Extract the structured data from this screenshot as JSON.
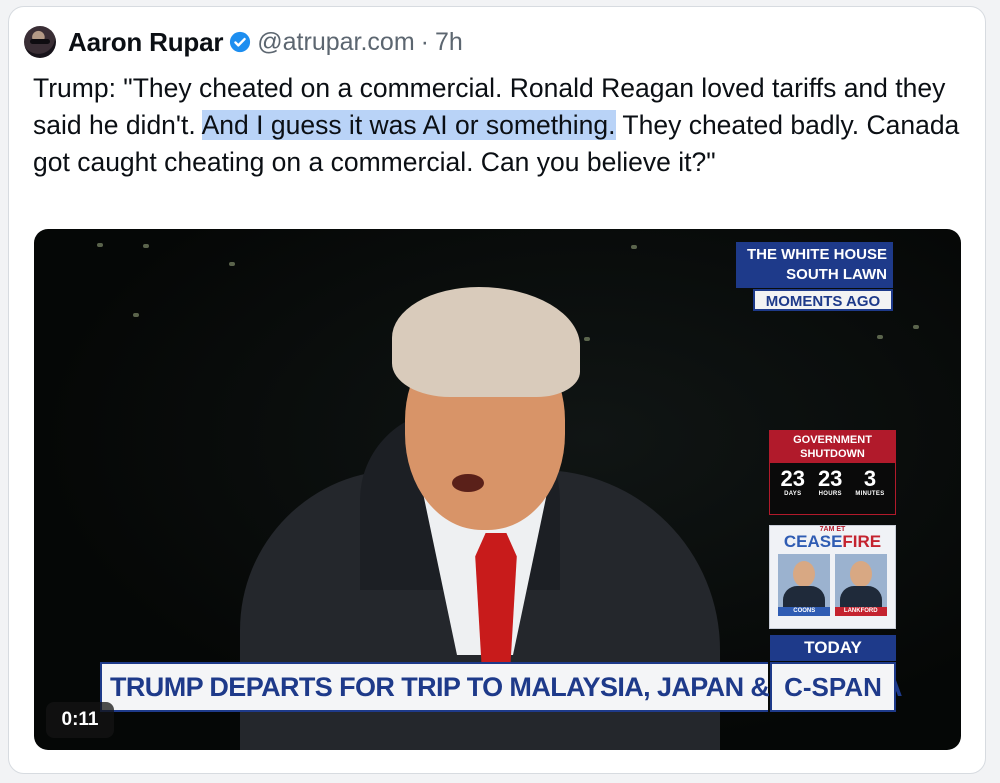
{
  "post": {
    "author_name": "Aaron Rupar",
    "handle": "@atrupar.com",
    "separator": "·",
    "time": "7h",
    "text_before": "Trump: \"They cheated on a commercial. Ronald Reagan loved tariffs and they said he didn't. ",
    "text_highlight": "And I guess it was AI or something.",
    "text_after": " They cheated badly. Canada got caught cheating on a commercial. Can you believe it?\""
  },
  "video": {
    "duration": "0:11",
    "location_line1": "THE WHITE HOUSE",
    "location_line2": "SOUTH LAWN",
    "moments": "MOMENTS AGO",
    "shutdown_title_line1": "GOVERNMENT",
    "shutdown_title_line2": "SHUTDOWN",
    "countdown": [
      {
        "value": "23",
        "label": "DAYS"
      },
      {
        "value": "23",
        "label": "HOURS"
      },
      {
        "value": "3",
        "label": "MINUTES"
      }
    ],
    "ceasefire_time": "7AM ET",
    "ceasefire_a": "CEASE",
    "ceasefire_b": "FIRE",
    "guest1": "COONS",
    "guest2": "LANKFORD",
    "today": "TODAY",
    "headline": "TRUMP DEPARTS FOR TRIP TO MALAYSIA, JAPAN & S. KOREA",
    "network": "C-SPAN"
  },
  "colors": {
    "highlight": "#b9d3f7",
    "verified": "#1d8ef0",
    "cspan_blue": "#1e3a8a",
    "shutdown_red": "#b11a2b"
  }
}
